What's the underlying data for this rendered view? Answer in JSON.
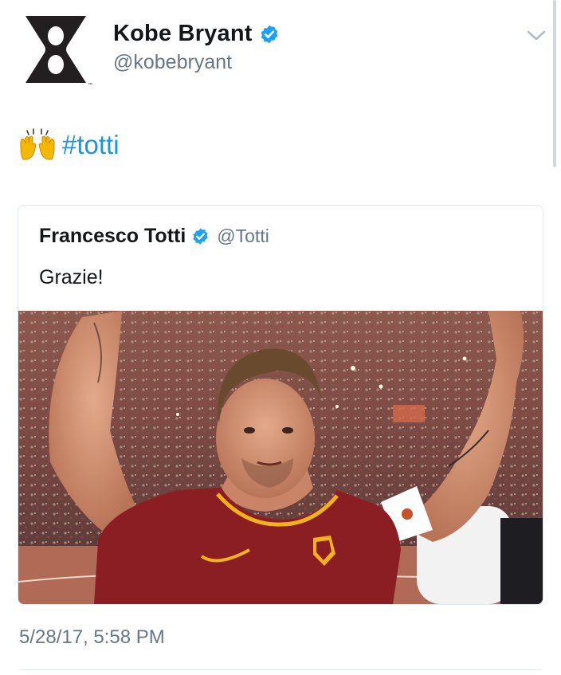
{
  "tweet": {
    "author": {
      "display_name": "Kobe Bryant",
      "handle": "@kobebryant",
      "verified": true,
      "avatar": "kobe-hourglass-logo"
    },
    "text": {
      "emoji": "raising-hands-emoji",
      "hashtag": "#totti"
    },
    "timestamp": "5/28/17, 5:58 PM",
    "menu_icon": "chevron-down-icon"
  },
  "quoted_tweet": {
    "display_name": "Francesco Totti",
    "handle": "@Totti",
    "verified": true,
    "text": "Grazie!",
    "media": "photo-totti-stadium"
  },
  "colors": {
    "link_blue": "#1b95e0",
    "verified_blue": "#1da1f2",
    "secondary_text": "#657786",
    "border": "#e1e8ed"
  }
}
